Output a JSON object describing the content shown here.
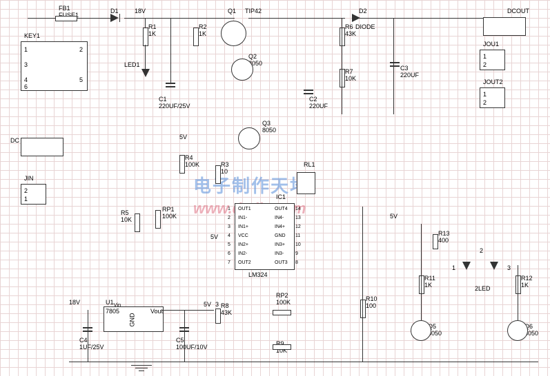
{
  "watermark": {
    "text1": "电子制作天地",
    "text2": "www.dzdiy.com"
  },
  "components": {
    "FB1": {
      "ref": "FB1",
      "name": "FUSE1"
    },
    "D1": {
      "ref": "D1"
    },
    "KEY1": {
      "ref": "KEY1",
      "pins": [
        "1",
        "2",
        "3",
        "4",
        "5",
        "6"
      ]
    },
    "LED1": {
      "ref": "LED1"
    },
    "DC": {
      "ref": "DC"
    },
    "JIN": {
      "ref": "JIN",
      "pins": [
        "1",
        "2"
      ]
    },
    "R1": {
      "ref": "R1",
      "val": "1K"
    },
    "R2": {
      "ref": "R2",
      "val": "1K"
    },
    "Q1": {
      "ref": "Q1",
      "val": "TIP42"
    },
    "Q2": {
      "ref": "Q2",
      "val": "8050"
    },
    "Q3": {
      "ref": "Q3",
      "val": "8050"
    },
    "C1": {
      "ref": "C1",
      "val": "220UF/25V"
    },
    "C2": {
      "ref": "C2",
      "val": "220UF"
    },
    "C3": {
      "ref": "C3",
      "val": "220UF"
    },
    "D2": {
      "ref": "D2"
    },
    "R6": {
      "ref": "R6",
      "val": "43K",
      "type": "DIODE"
    },
    "R7": {
      "ref": "R7",
      "val": "10K"
    },
    "R3": {
      "ref": "R3",
      "val": "10"
    },
    "R4": {
      "ref": "R4",
      "val": "100K"
    },
    "R5": {
      "ref": "R5",
      "val": "10K"
    },
    "RP1": {
      "ref": "RP1",
      "val": "100K"
    },
    "RL1": {
      "ref": "RL1"
    },
    "IC1": {
      "ref": "IC1",
      "val": "LM324",
      "pins_left": [
        "OUT1",
        "IN1-",
        "IN1+",
        "VCC",
        "IN2+",
        "IN2-",
        "OUT2"
      ],
      "pins_right": [
        "OUT4",
        "IN4-",
        "IN4+",
        "GND",
        "IN3+",
        "IN3-",
        "OUT3"
      ],
      "nums_left": [
        "1",
        "2",
        "3",
        "4",
        "5",
        "6",
        "7"
      ],
      "nums_right": [
        "14",
        "13",
        "12",
        "11",
        "10",
        "9",
        "8"
      ]
    },
    "U1": {
      "ref": "U1",
      "val": "7805",
      "pins": [
        "Vin",
        "GND",
        "Vout"
      ]
    },
    "C4": {
      "ref": "C4",
      "val": "1UF/25V"
    },
    "C5": {
      "ref": "C5",
      "val": "100UF/10V"
    },
    "R8": {
      "ref": "R8",
      "val": "43K"
    },
    "RP2": {
      "ref": "RP2",
      "val": "100K"
    },
    "R9": {
      "ref": "R9",
      "val": "10K"
    },
    "R10": {
      "ref": "R10",
      "val": "100"
    },
    "R11": {
      "ref": "R11",
      "val": "1K"
    },
    "R12": {
      "ref": "R12",
      "val": "1K"
    },
    "R13": {
      "ref": "R13",
      "val": "400"
    },
    "Q5": {
      "ref": "Q5",
      "val": "8050"
    },
    "Q6": {
      "ref": "Q6",
      "val": "8050"
    },
    "LED2": {
      "ref": "2LED",
      "pins": [
        "1",
        "2",
        "3"
      ]
    },
    "DCOUT": {
      "ref": "DCOUT"
    },
    "JOU1": {
      "ref": "JOU1",
      "pins": [
        "1",
        "2"
      ]
    },
    "JOUT2": {
      "ref": "JOUT2",
      "pins": [
        "1",
        "2"
      ]
    }
  },
  "nodes": {
    "18V": "18V",
    "5V": "5V"
  }
}
